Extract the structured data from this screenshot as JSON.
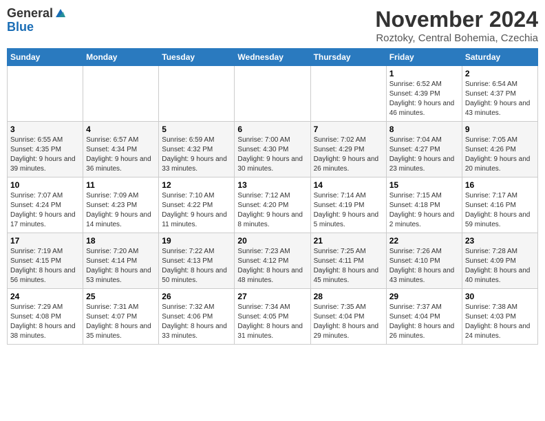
{
  "header": {
    "logo_general": "General",
    "logo_blue": "Blue",
    "month_title": "November 2024",
    "location": "Roztoky, Central Bohemia, Czechia"
  },
  "days_of_week": [
    "Sunday",
    "Monday",
    "Tuesday",
    "Wednesday",
    "Thursday",
    "Friday",
    "Saturday"
  ],
  "weeks": [
    [
      {
        "day": "",
        "info": ""
      },
      {
        "day": "",
        "info": ""
      },
      {
        "day": "",
        "info": ""
      },
      {
        "day": "",
        "info": ""
      },
      {
        "day": "",
        "info": ""
      },
      {
        "day": "1",
        "info": "Sunrise: 6:52 AM\nSunset: 4:39 PM\nDaylight: 9 hours and 46 minutes."
      },
      {
        "day": "2",
        "info": "Sunrise: 6:54 AM\nSunset: 4:37 PM\nDaylight: 9 hours and 43 minutes."
      }
    ],
    [
      {
        "day": "3",
        "info": "Sunrise: 6:55 AM\nSunset: 4:35 PM\nDaylight: 9 hours and 39 minutes."
      },
      {
        "day": "4",
        "info": "Sunrise: 6:57 AM\nSunset: 4:34 PM\nDaylight: 9 hours and 36 minutes."
      },
      {
        "day": "5",
        "info": "Sunrise: 6:59 AM\nSunset: 4:32 PM\nDaylight: 9 hours and 33 minutes."
      },
      {
        "day": "6",
        "info": "Sunrise: 7:00 AM\nSunset: 4:30 PM\nDaylight: 9 hours and 30 minutes."
      },
      {
        "day": "7",
        "info": "Sunrise: 7:02 AM\nSunset: 4:29 PM\nDaylight: 9 hours and 26 minutes."
      },
      {
        "day": "8",
        "info": "Sunrise: 7:04 AM\nSunset: 4:27 PM\nDaylight: 9 hours and 23 minutes."
      },
      {
        "day": "9",
        "info": "Sunrise: 7:05 AM\nSunset: 4:26 PM\nDaylight: 9 hours and 20 minutes."
      }
    ],
    [
      {
        "day": "10",
        "info": "Sunrise: 7:07 AM\nSunset: 4:24 PM\nDaylight: 9 hours and 17 minutes."
      },
      {
        "day": "11",
        "info": "Sunrise: 7:09 AM\nSunset: 4:23 PM\nDaylight: 9 hours and 14 minutes."
      },
      {
        "day": "12",
        "info": "Sunrise: 7:10 AM\nSunset: 4:22 PM\nDaylight: 9 hours and 11 minutes."
      },
      {
        "day": "13",
        "info": "Sunrise: 7:12 AM\nSunset: 4:20 PM\nDaylight: 9 hours and 8 minutes."
      },
      {
        "day": "14",
        "info": "Sunrise: 7:14 AM\nSunset: 4:19 PM\nDaylight: 9 hours and 5 minutes."
      },
      {
        "day": "15",
        "info": "Sunrise: 7:15 AM\nSunset: 4:18 PM\nDaylight: 9 hours and 2 minutes."
      },
      {
        "day": "16",
        "info": "Sunrise: 7:17 AM\nSunset: 4:16 PM\nDaylight: 8 hours and 59 minutes."
      }
    ],
    [
      {
        "day": "17",
        "info": "Sunrise: 7:19 AM\nSunset: 4:15 PM\nDaylight: 8 hours and 56 minutes."
      },
      {
        "day": "18",
        "info": "Sunrise: 7:20 AM\nSunset: 4:14 PM\nDaylight: 8 hours and 53 minutes."
      },
      {
        "day": "19",
        "info": "Sunrise: 7:22 AM\nSunset: 4:13 PM\nDaylight: 8 hours and 50 minutes."
      },
      {
        "day": "20",
        "info": "Sunrise: 7:23 AM\nSunset: 4:12 PM\nDaylight: 8 hours and 48 minutes."
      },
      {
        "day": "21",
        "info": "Sunrise: 7:25 AM\nSunset: 4:11 PM\nDaylight: 8 hours and 45 minutes."
      },
      {
        "day": "22",
        "info": "Sunrise: 7:26 AM\nSunset: 4:10 PM\nDaylight: 8 hours and 43 minutes."
      },
      {
        "day": "23",
        "info": "Sunrise: 7:28 AM\nSunset: 4:09 PM\nDaylight: 8 hours and 40 minutes."
      }
    ],
    [
      {
        "day": "24",
        "info": "Sunrise: 7:29 AM\nSunset: 4:08 PM\nDaylight: 8 hours and 38 minutes."
      },
      {
        "day": "25",
        "info": "Sunrise: 7:31 AM\nSunset: 4:07 PM\nDaylight: 8 hours and 35 minutes."
      },
      {
        "day": "26",
        "info": "Sunrise: 7:32 AM\nSunset: 4:06 PM\nDaylight: 8 hours and 33 minutes."
      },
      {
        "day": "27",
        "info": "Sunrise: 7:34 AM\nSunset: 4:05 PM\nDaylight: 8 hours and 31 minutes."
      },
      {
        "day": "28",
        "info": "Sunrise: 7:35 AM\nSunset: 4:04 PM\nDaylight: 8 hours and 29 minutes."
      },
      {
        "day": "29",
        "info": "Sunrise: 7:37 AM\nSunset: 4:04 PM\nDaylight: 8 hours and 26 minutes."
      },
      {
        "day": "30",
        "info": "Sunrise: 7:38 AM\nSunset: 4:03 PM\nDaylight: 8 hours and 24 minutes."
      }
    ]
  ]
}
